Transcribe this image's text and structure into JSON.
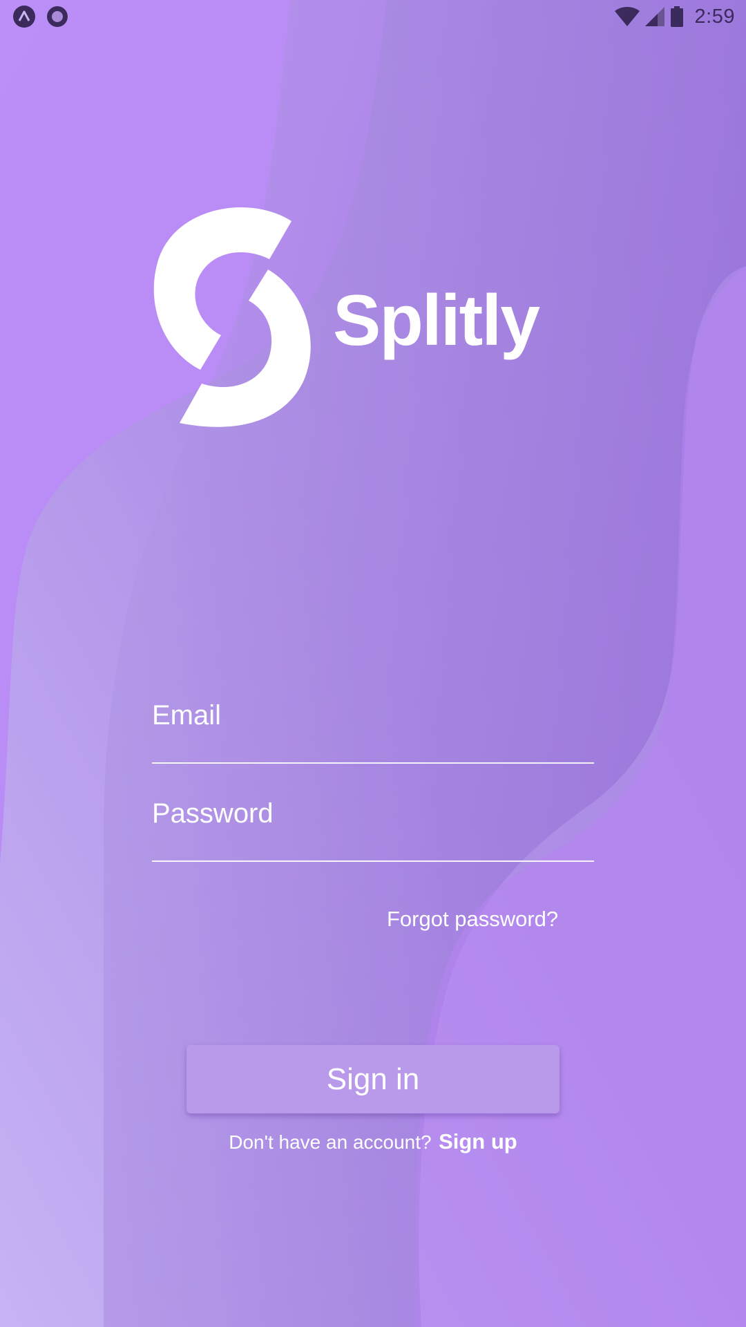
{
  "app": {
    "name": "Splitly",
    "accent_color": "#b98cf6"
  },
  "status_bar": {
    "left_icons": [
      "expo-icon",
      "record-icon"
    ],
    "right_icons": [
      "wifi-icon",
      "cellular-signal-icon",
      "battery-icon"
    ],
    "time": "2:59"
  },
  "logo": {
    "icon": "splitly-logo-icon",
    "text": "Splitly"
  },
  "form": {
    "email_placeholder": "Email",
    "email_value": "",
    "password_placeholder": "Password",
    "password_value": "",
    "forgot_password_label": "Forgot password?",
    "sign_in_label": "Sign in",
    "signup_prompt": "Don't have an account?",
    "signup_link": "Sign up"
  }
}
